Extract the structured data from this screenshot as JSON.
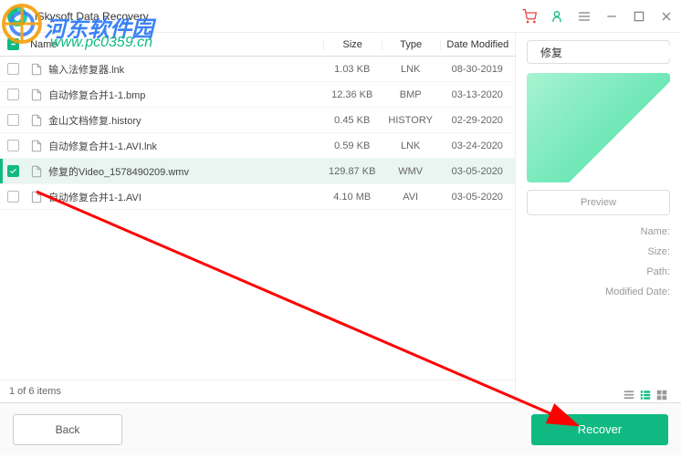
{
  "app": {
    "title": "iSkysoft Data Recovery"
  },
  "watermark": {
    "text": "河东软件园",
    "url": "www.pc0359.cn"
  },
  "table": {
    "headers": {
      "name": "Name",
      "size": "Size",
      "type": "Type",
      "date": "Date Modified"
    },
    "rows": [
      {
        "checked": false,
        "name": "输入法修复器.lnk",
        "size": "1.03 KB",
        "type": "LNK",
        "date": "08-30-2019",
        "selected": false
      },
      {
        "checked": false,
        "name": "自动修复合并1-1.bmp",
        "size": "12.36 KB",
        "type": "BMP",
        "date": "03-13-2020",
        "selected": false
      },
      {
        "checked": false,
        "name": "金山文档修复.history",
        "size": "0.45 KB",
        "type": "HISTORY",
        "date": "02-29-2020",
        "selected": false
      },
      {
        "checked": false,
        "name": "自动修复合并1-1.AVI.lnk",
        "size": "0.59 KB",
        "type": "LNK",
        "date": "03-24-2020",
        "selected": false
      },
      {
        "checked": true,
        "name": "修复的Video_1578490209.wmv",
        "size": "129.87 KB",
        "type": "WMV",
        "date": "03-05-2020",
        "selected": true
      },
      {
        "checked": false,
        "name": "自动修复合并1-1.AVI",
        "size": "4.10 MB",
        "type": "AVI",
        "date": "03-05-2020",
        "selected": false
      }
    ]
  },
  "status": "1 of 6 items",
  "search": {
    "value": "修复"
  },
  "preview": {
    "button": "Preview"
  },
  "info": {
    "name": "Name:",
    "size": "Size:",
    "path": "Path:",
    "modified": "Modified Date:"
  },
  "buttons": {
    "back": "Back",
    "recover": "Recover"
  }
}
